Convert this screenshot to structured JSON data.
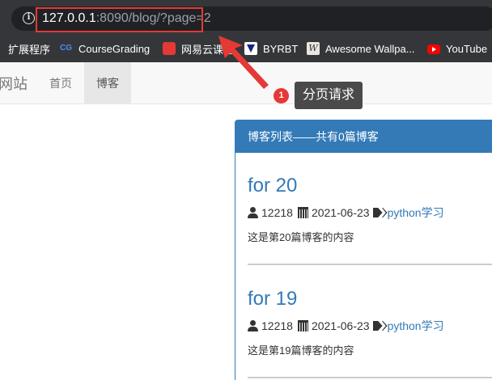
{
  "browser": {
    "url_host": "127.0.0.1",
    "url_rest": ":8090/blog/?page=2",
    "bookmarks": [
      {
        "label": "扩展程序",
        "icon": "apps-icon"
      },
      {
        "label": "CourseGrading",
        "icon": "coursegrading-icon"
      },
      {
        "label": "网易云课堂",
        "icon": "netease-study-icon"
      },
      {
        "label": "BYRBT",
        "icon": "byrbt-icon"
      },
      {
        "label": "Awesome Wallpa...",
        "icon": "wallpaper-icon"
      },
      {
        "label": "YouTube",
        "icon": "youtube-icon"
      }
    ]
  },
  "navbar": {
    "brand": "网站",
    "links": [
      {
        "label": "首页",
        "active": false
      },
      {
        "label": "博客",
        "active": true
      }
    ]
  },
  "annotation": {
    "number": "1",
    "text": "分页请求",
    "color": "#e53935"
  },
  "panel": {
    "title": "博客列表——共有0篇博客",
    "color": "#337ab7"
  },
  "posts": [
    {
      "title": "for 20",
      "author": "12218",
      "date": "2021-06-23",
      "tag": "python学习",
      "excerpt": "这是第20篇博客的内容"
    },
    {
      "title": "for 19",
      "author": "12218",
      "date": "2021-06-23",
      "tag": "python学习",
      "excerpt": "这是第19篇博客的内容"
    }
  ]
}
